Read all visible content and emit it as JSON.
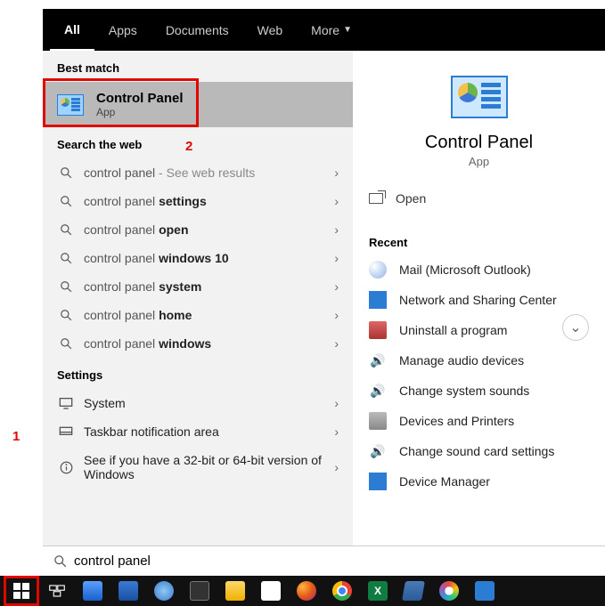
{
  "tabs": {
    "all": "All",
    "apps": "Apps",
    "documents": "Documents",
    "web": "Web",
    "more": "More"
  },
  "left": {
    "best_label": "Best match",
    "best": {
      "title": "Control Panel",
      "sub": "App"
    },
    "web_label": "Search the web",
    "web_rows": [
      {
        "prefix": "control panel",
        "bold": "",
        "hint": " - See web results"
      },
      {
        "prefix": "control panel ",
        "bold": "settings",
        "hint": ""
      },
      {
        "prefix": "control panel ",
        "bold": "open",
        "hint": ""
      },
      {
        "prefix": "control panel ",
        "bold": "windows 10",
        "hint": ""
      },
      {
        "prefix": "control panel ",
        "bold": "system",
        "hint": ""
      },
      {
        "prefix": "control panel ",
        "bold": "home",
        "hint": ""
      },
      {
        "prefix": "control panel ",
        "bold": "windows",
        "hint": ""
      }
    ],
    "settings_label": "Settings",
    "settings_rows": [
      {
        "label": "System"
      },
      {
        "label": "Taskbar notification area"
      },
      {
        "label": "See if you have a 32-bit or 64-bit version of Windows"
      }
    ]
  },
  "right": {
    "title": "Control Panel",
    "sub": "App",
    "open": "Open",
    "recent_label": "Recent",
    "recent": [
      "Mail (Microsoft Outlook)",
      "Network and Sharing Center",
      "Uninstall a program",
      "Manage audio devices",
      "Change system sounds",
      "Devices and Printers",
      "Change sound card settings",
      "Device Manager"
    ]
  },
  "search": {
    "value": "control panel"
  },
  "annotations": {
    "one": "1",
    "two": "2"
  }
}
